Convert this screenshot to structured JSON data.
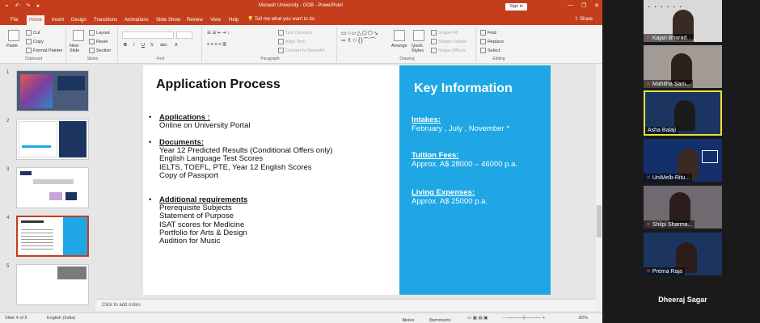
{
  "window": {
    "title": "Monash University - GOB  -  PowerPoint",
    "signin_label": "Sign in",
    "minimize": "—",
    "restore": "❐",
    "close": "✕"
  },
  "tabs": [
    "File",
    "Home",
    "Insert",
    "Design",
    "Transitions",
    "Animations",
    "Slide Show",
    "Review",
    "View",
    "Help"
  ],
  "tell_me": "Tell me what you want to do",
  "share": "Share",
  "ribbon": {
    "clipboard": {
      "label": "Clipboard",
      "paste": "Paste",
      "cut": "Cut",
      "copy": "Copy",
      "format_painter": "Format Painter"
    },
    "slides": {
      "label": "Slides",
      "new_slide": "New Slide",
      "layout": "Layout",
      "reset": "Reset",
      "section": "Section"
    },
    "font": {
      "label": "Font"
    },
    "paragraph": {
      "label": "Paragraph",
      "text_direction": "Text Direction",
      "align_text": "Align Text",
      "smartart": "Convert to SmartArt"
    },
    "drawing": {
      "label": "Drawing",
      "arrange": "Arrange",
      "quick_styles": "Quick Styles",
      "shape_fill": "Shape Fill",
      "shape_outline": "Shape Outline",
      "shape_effects": "Shape Effects"
    },
    "editing": {
      "label": "Editing",
      "find": "Find",
      "replace": "Replace",
      "select": "Select"
    }
  },
  "thumbnails": [
    {
      "num": "1"
    },
    {
      "num": "2"
    },
    {
      "num": "3"
    },
    {
      "num": "4"
    },
    {
      "num": "5"
    }
  ],
  "slide": {
    "title": "Application Process",
    "sections": [
      {
        "head": "Applications :",
        "items": [
          "Online on University Portal"
        ]
      },
      {
        "head": "Documents:",
        "items": [
          "Year 12 Predicted Results (Conditional Offers only)",
          "English Language Test Scores",
          "IELTS, TOEFL, PTE, Year 12 English Scores",
          "Copy of Passport"
        ]
      },
      {
        "head": "Additional requirements",
        "items": [
          "Prerequisite Subjects",
          "Statement of Purpose",
          "ISAT scores for Medicine",
          "Portfolio for Arts & Design",
          "Audition for Music"
        ]
      }
    ],
    "key_title": "Key Information",
    "key_blocks": [
      {
        "head": "Intakes:",
        "value": "February , July , November *"
      },
      {
        "head": "Tuition Fees:",
        "value": "Approx. A$ 28000 – 46000 p.a."
      },
      {
        "head": "Living Expenses:",
        "value": "Approx. A$ 25000 p.a."
      }
    ],
    "bullet": "•"
  },
  "notes_placeholder": "Click to add notes",
  "status": {
    "slide_of": "Slide 4 of 5",
    "language": "English (India)",
    "notes": "Notes",
    "comments": "Comments",
    "zoom": "82%"
  },
  "participants": [
    {
      "name": "Kajari Bharad..."
    },
    {
      "name": "Mahitha Sam..."
    },
    {
      "name": "Asha Balaji"
    },
    {
      "name": "UniMelb-Ritu..."
    },
    {
      "name": "Shilpi Sharma..."
    },
    {
      "name": "Prema Raja"
    }
  ],
  "bottom_participant": "Dheeraj Sagar",
  "colors": {
    "accent": "#c43e1c",
    "slide_blue": "#1ea7e4",
    "active_speaker": "#e8e23a"
  }
}
